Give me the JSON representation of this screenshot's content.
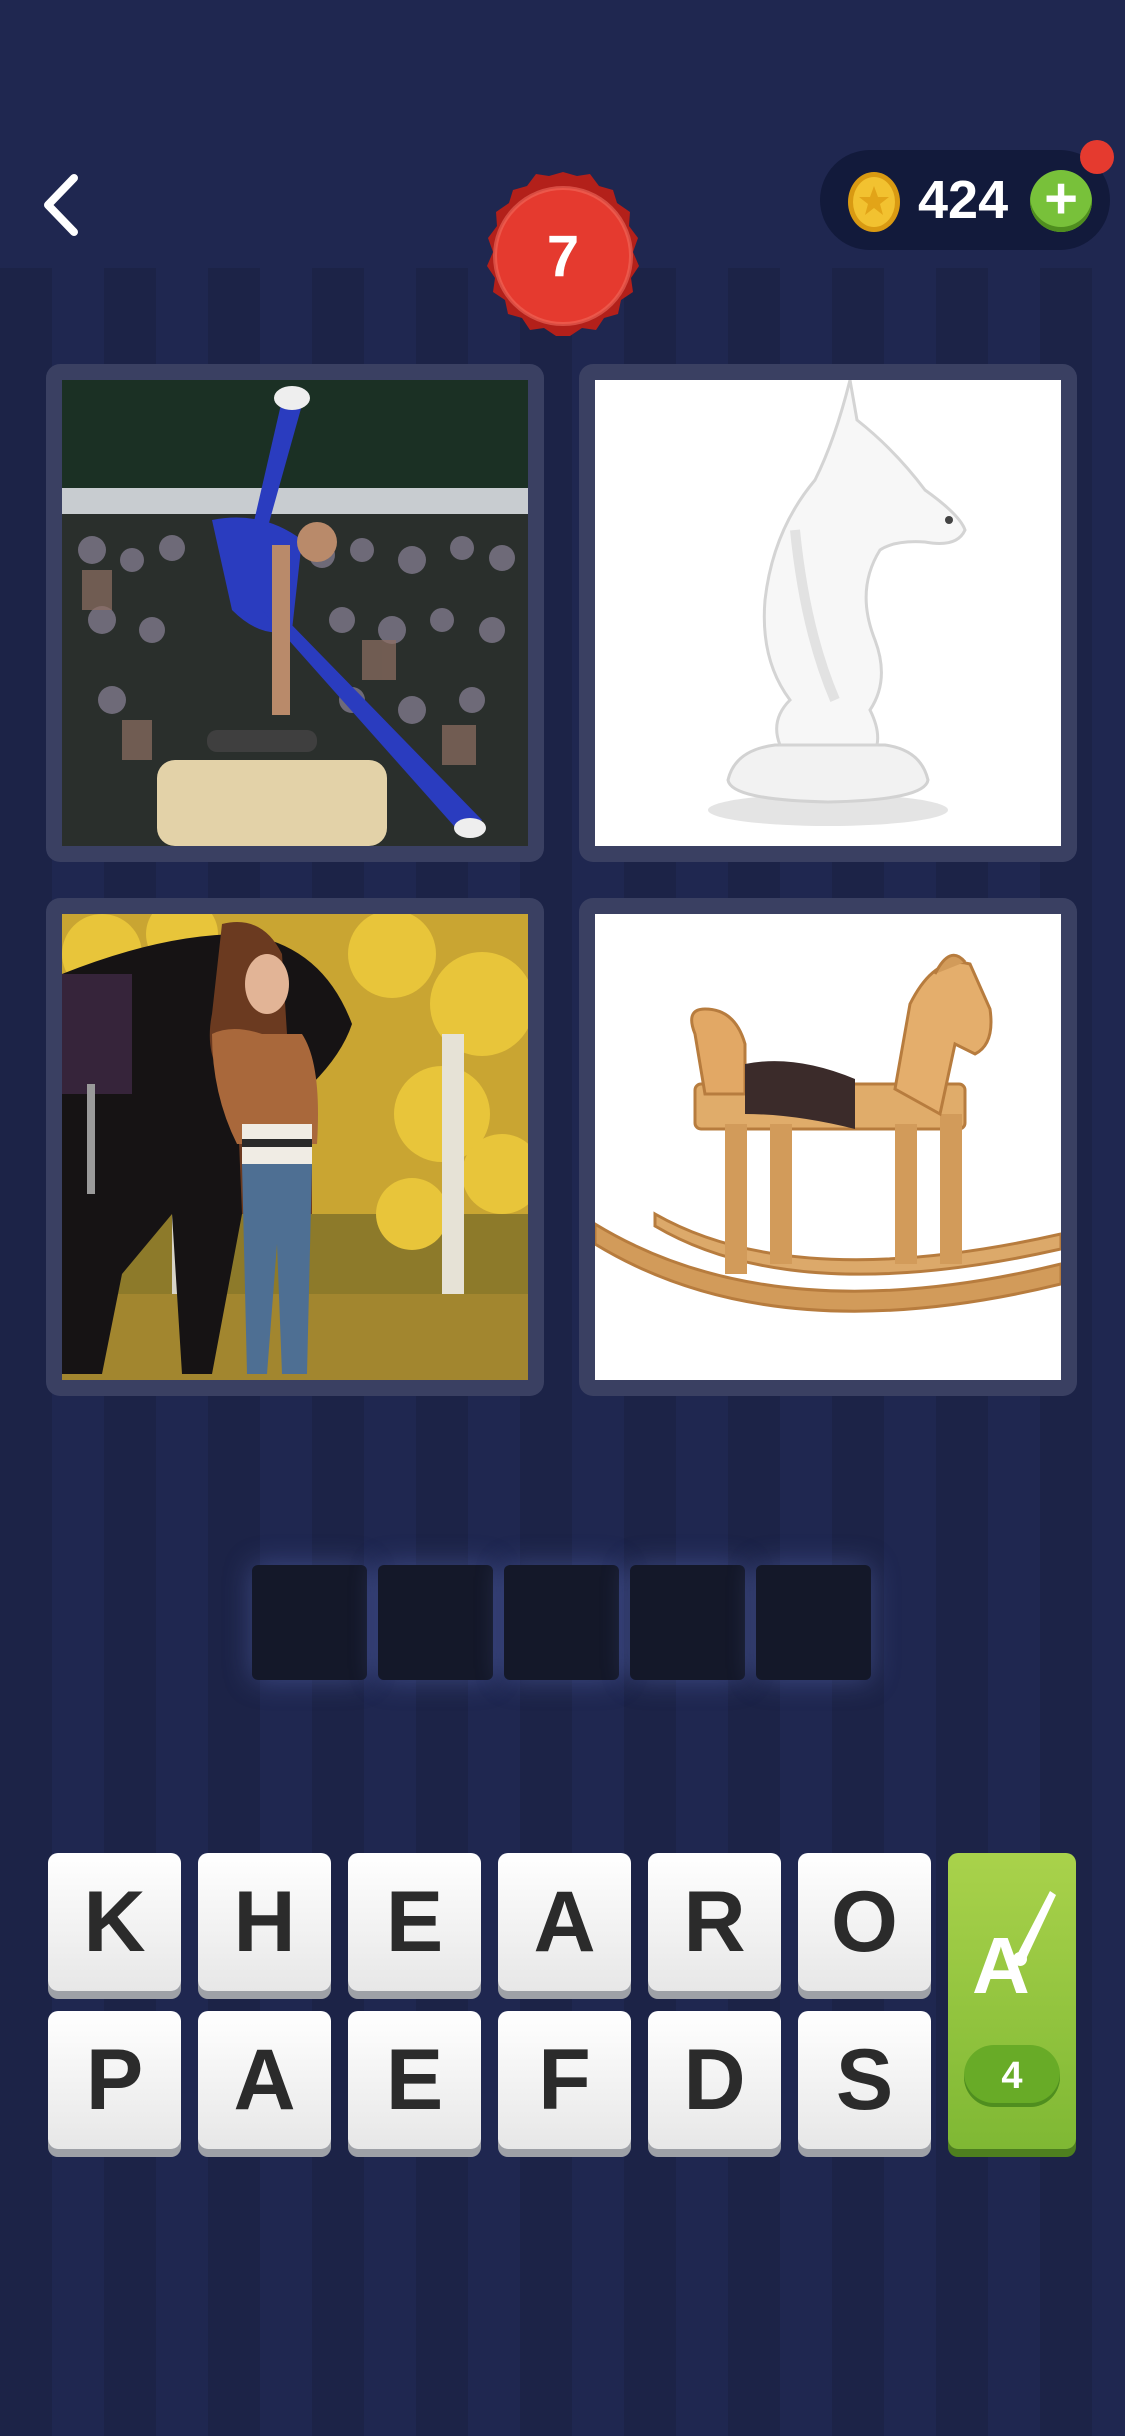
{
  "header": {
    "level": "7",
    "coins": "424",
    "plus_label": "+"
  },
  "clues": [
    {
      "description": "gymnast on pommel horse"
    },
    {
      "description": "white chess knight"
    },
    {
      "description": "woman with dark horse in autumn"
    },
    {
      "description": "wooden rocking horse"
    }
  ],
  "answer": {
    "length": 5
  },
  "letters": {
    "row1": [
      "K",
      "H",
      "E",
      "A",
      "R",
      "O"
    ],
    "row2": [
      "P",
      "A",
      "E",
      "F",
      "D",
      "S"
    ]
  },
  "hint": {
    "count": "4"
  },
  "colors": {
    "badge": "#e53a2f",
    "hint_green": "#8dc63f",
    "coin": "#f2b41c",
    "background": "#1c2347"
  }
}
